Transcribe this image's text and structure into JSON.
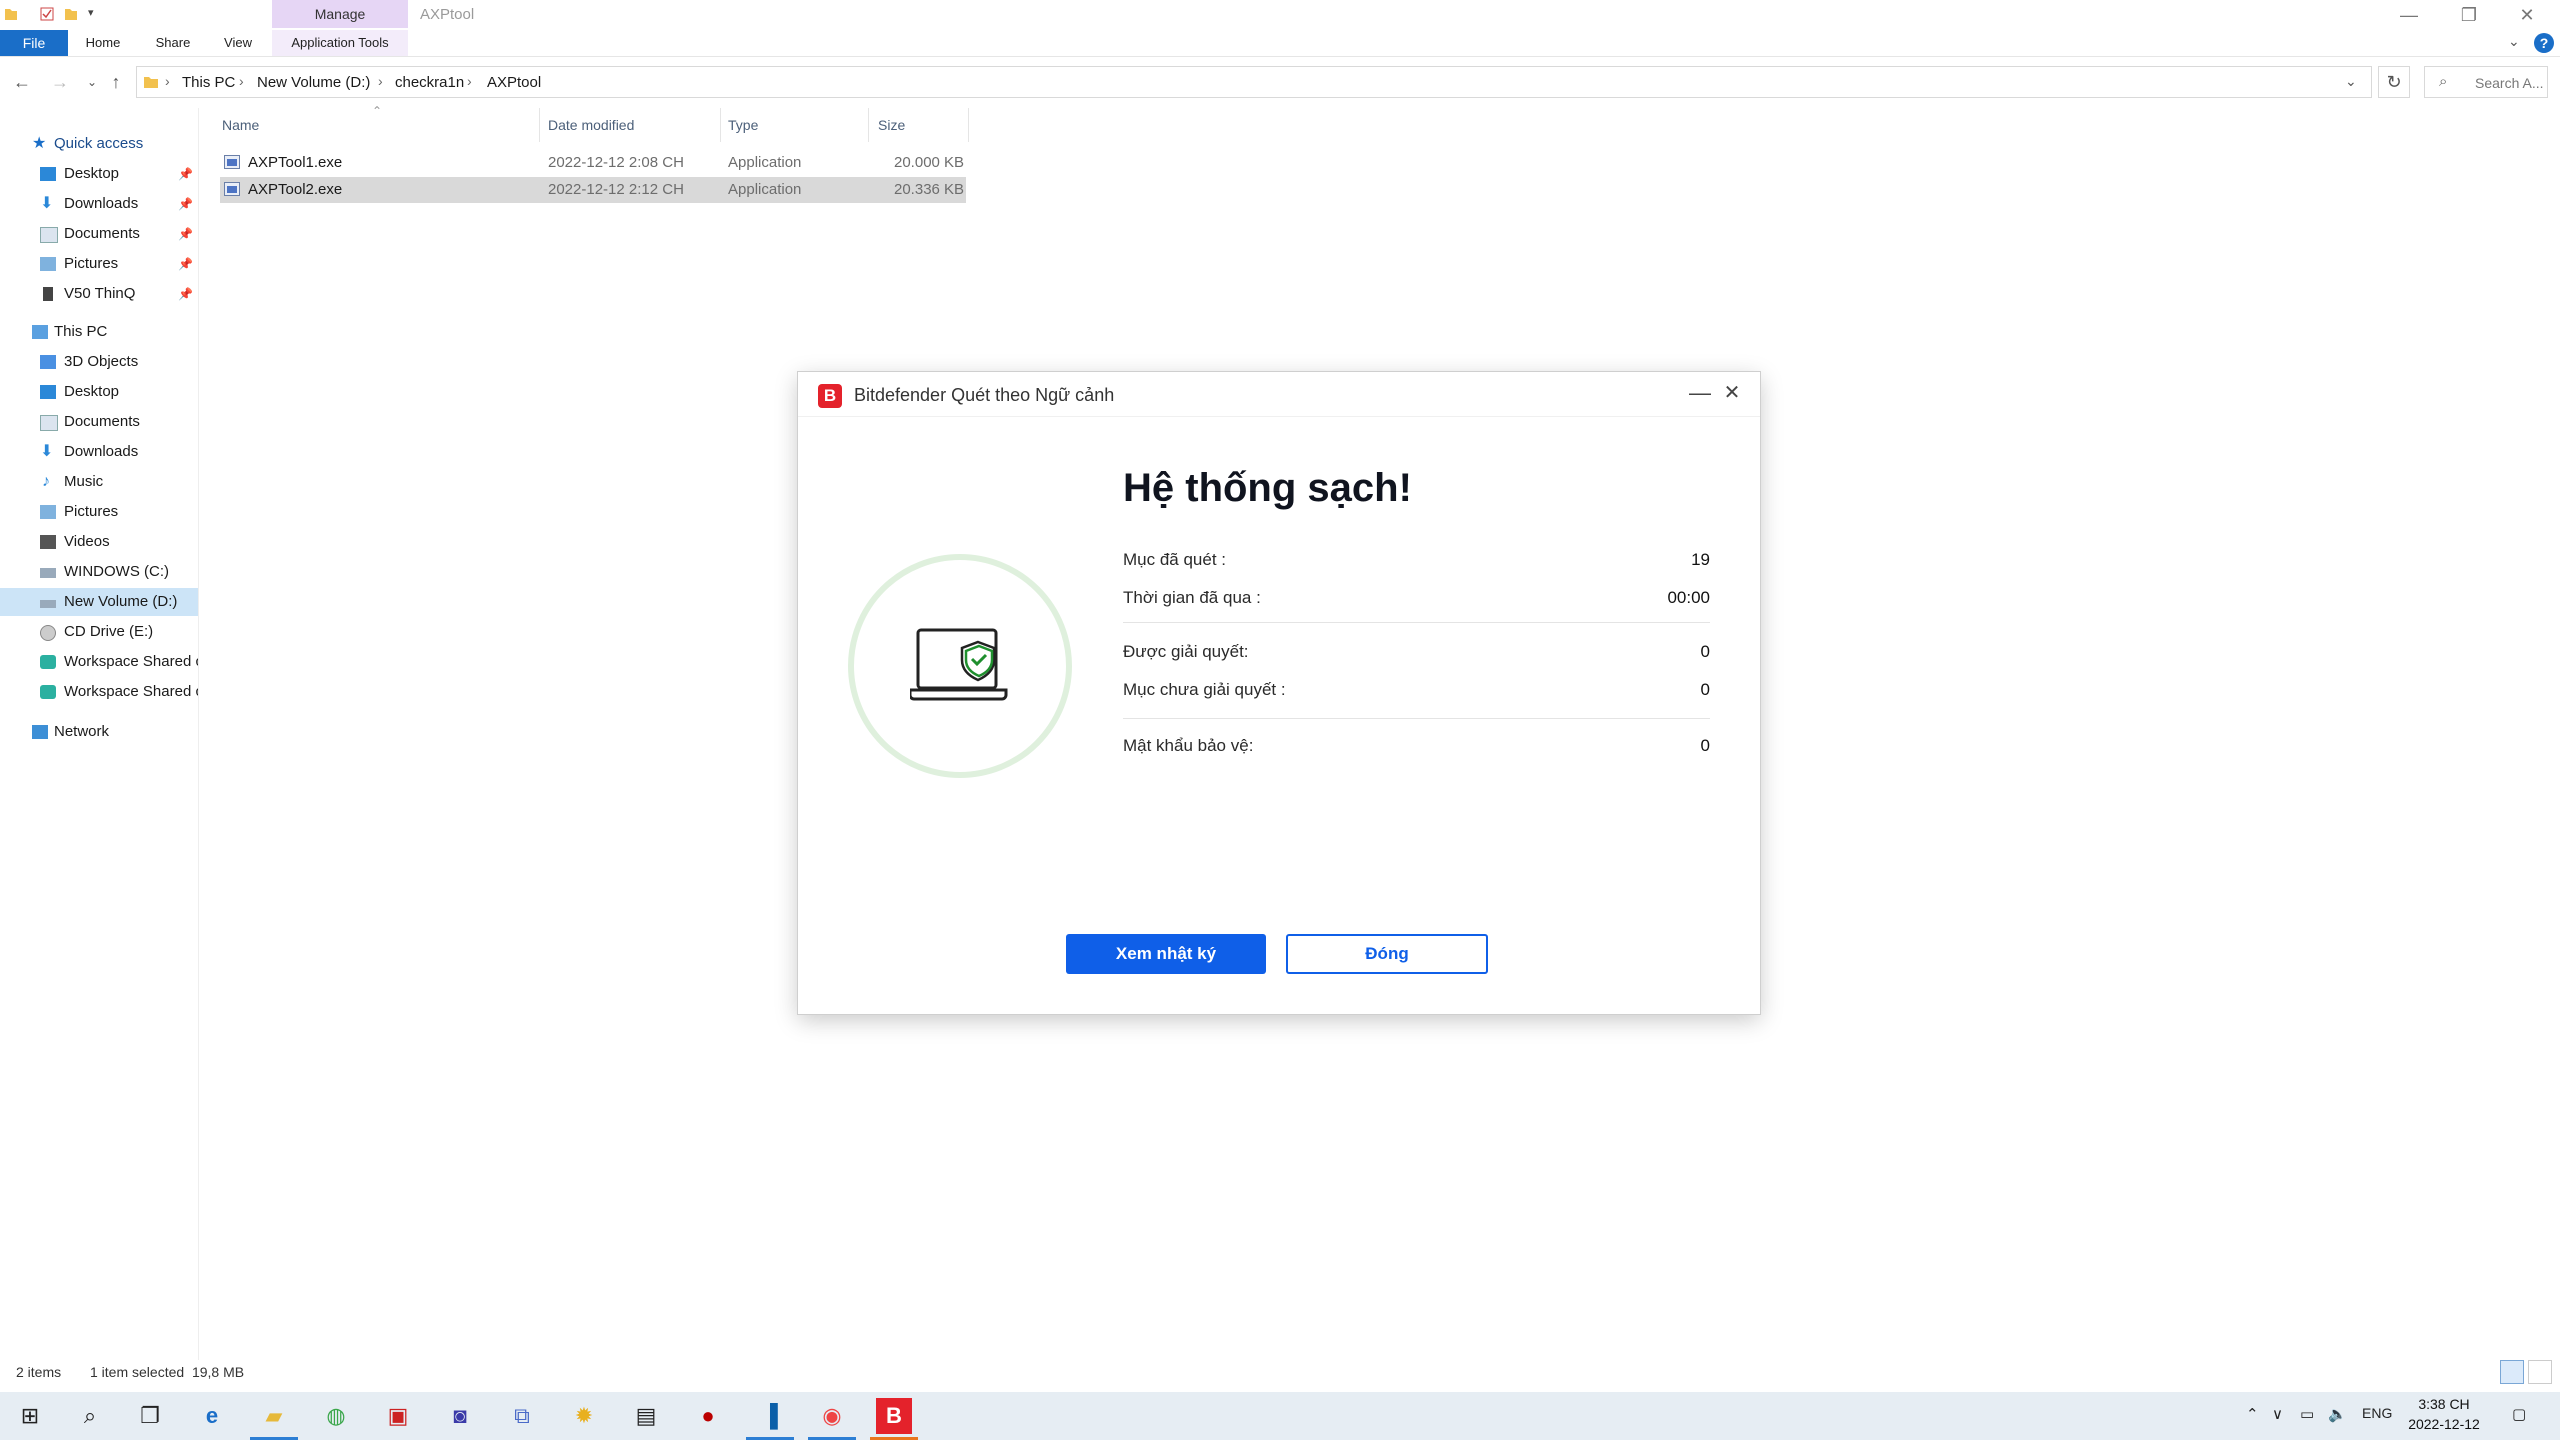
{
  "window": {
    "title": "AXPtool",
    "context_tab": "Manage",
    "minimize_glyph": "—",
    "restore_glyph": "❐",
    "close_glyph": "✕"
  },
  "ribbon": {
    "file": "File",
    "home": "Home",
    "share": "Share",
    "view": "View",
    "app_tools": "Application Tools",
    "help": "?"
  },
  "address": {
    "crumbs": [
      "This PC",
      "New Volume (D:)",
      "checkra1n",
      "AXPtool"
    ],
    "search_placeholder": "Search A..."
  },
  "nav": {
    "quick_access": "Quick access",
    "quick_items": [
      "Desktop",
      "Downloads",
      "Documents",
      "Pictures",
      "V50 ThinQ"
    ],
    "this_pc": "This PC",
    "pc_items": [
      "3D Objects",
      "Desktop",
      "Documents",
      "Downloads",
      "Music",
      "Pictures",
      "Videos",
      "WINDOWS (C:)",
      "New Volume (D:)",
      "CD Drive (E:)",
      "Workspace Shared c",
      "Workspace Shared c"
    ],
    "network": "Network"
  },
  "file_list": {
    "columns": [
      "Name",
      "Date modified",
      "Type",
      "Size"
    ],
    "rows": [
      {
        "name": "AXPTool1.exe",
        "date": "2022-12-12 2:08 CH",
        "type": "Application",
        "size": "20.000 KB"
      },
      {
        "name": "AXPTool2.exe",
        "date": "2022-12-12 2:12 CH",
        "type": "Application",
        "size": "20.336 KB"
      }
    ]
  },
  "status": {
    "count": "2 items",
    "selection": "1 item selected  19,8 MB"
  },
  "dialog": {
    "logo": "B",
    "title": "Bitdefender Quét theo Ngữ cảnh",
    "headline": "Hệ thống sạch!",
    "stats": [
      {
        "label": "Mục đã quét :",
        "value": "19"
      },
      {
        "label": "Thời gian đã qua :",
        "value": "00:00"
      },
      {
        "label": "Được giải quyết:",
        "value": "0"
      },
      {
        "label": "Mục chưa giải quyết :",
        "value": "0"
      },
      {
        "label": "Mật khẩu bảo vệ:",
        "value": "0"
      }
    ],
    "primary_button": "Xem nhật ký",
    "secondary_button": "Đóng",
    "accent_color": "#0f5fe8",
    "brand_color": "#e4222b"
  },
  "taskbar": {
    "tray_lang": "ENG",
    "time": "3:38 CH",
    "date": "2022-12-12"
  }
}
